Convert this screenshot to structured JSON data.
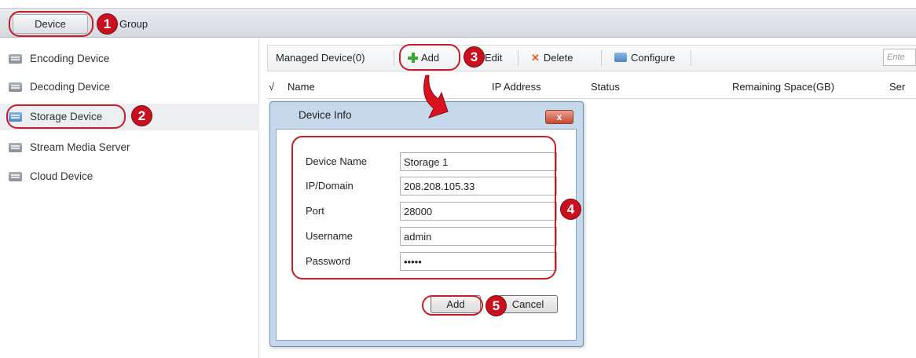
{
  "top_tabs": {
    "device": "Device",
    "group": "Group"
  },
  "sidebar": {
    "items": [
      {
        "label": "Encoding Device",
        "icon": "device-icon"
      },
      {
        "label": "Decoding Device",
        "icon": "device-icon"
      },
      {
        "label": "Storage Device",
        "icon": "storage-icon",
        "active": true
      },
      {
        "label": "Stream Media Server",
        "icon": "server-icon"
      },
      {
        "label": "Cloud Device",
        "icon": "device-icon"
      }
    ]
  },
  "toolbar": {
    "managed": "Managed Device(0)",
    "add": "Add",
    "edit": "Edit",
    "delete": "Delete",
    "configure": "Configure",
    "search_placeholder": "Ente"
  },
  "table": {
    "check": "√",
    "columns": [
      "Name",
      "IP Address",
      "Status",
      "Remaining Space(GB)",
      "Ser"
    ]
  },
  "dialog": {
    "title": "Device Info",
    "close": "x",
    "fields": [
      {
        "label": "Device Name",
        "value": "Storage 1"
      },
      {
        "label": "IP/Domain",
        "value": "208.208.105.33"
      },
      {
        "label": "Port",
        "value": "28000"
      },
      {
        "label": "Username",
        "value": "admin"
      },
      {
        "label": "Password",
        "value": "•••••"
      }
    ],
    "add_button": "Add",
    "cancel_button": "Cancel"
  },
  "annotations": [
    "1",
    "2",
    "3",
    "4",
    "5"
  ],
  "colors": {
    "annotation": "#c41e2a",
    "dialog_frame": "#c6d8ec"
  }
}
